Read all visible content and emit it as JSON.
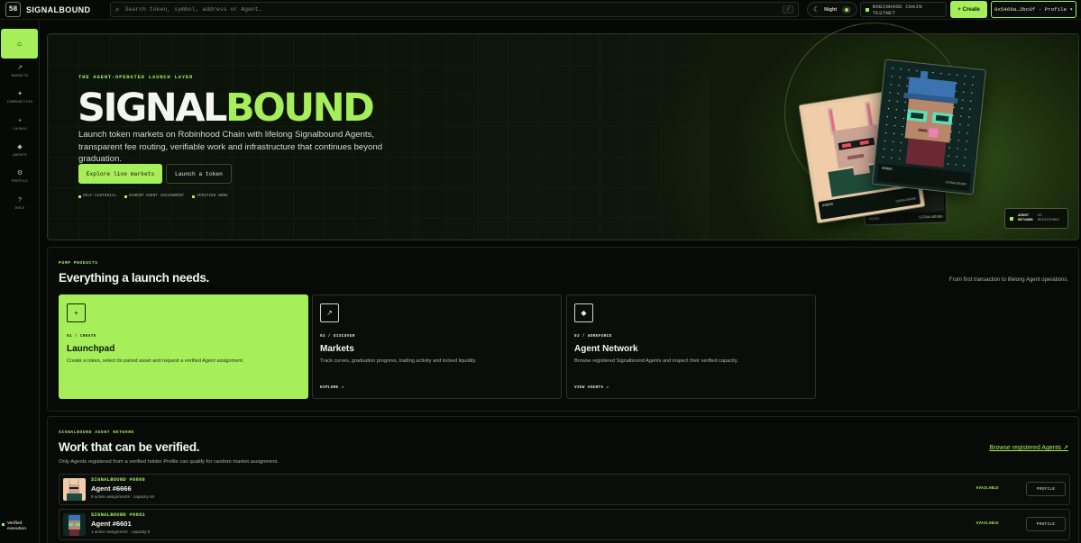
{
  "topbar": {
    "brand_logo": "58",
    "brand_name": "SIGNALBOUND",
    "search_placeholder": "Search token, symbol, address or Agent…",
    "search_kbd": "/",
    "theme_label": "Night",
    "network_label": "ROBINHOOD CHAIN TESTNET",
    "create_label": "+ Create",
    "profile_label": "0x5469a…2bc0f · Profile ▾"
  },
  "sidebar": {
    "items": [
      {
        "icon": "⌂",
        "label": ""
      },
      {
        "icon": "↗",
        "label": "MARKETS"
      },
      {
        "icon": "✦",
        "label": "COMMUNITIES"
      },
      {
        "icon": "+",
        "label": "LAUNCH"
      },
      {
        "icon": "◆",
        "label": "AGENTS"
      },
      {
        "icon": "⚙",
        "label": "PROFILE"
      },
      {
        "icon": "?",
        "label": "DOCS"
      }
    ],
    "footer_line1": "Verified",
    "footer_line2": "execution"
  },
  "hero": {
    "eyebrow": "THE AGENT-OPERATED LAUNCH LAYER",
    "title_white": "SIGNAL",
    "title_green": "BOUND",
    "description": "Launch token markets on Robinhood Chain with lifelong Signalbound Agents, transparent fee routing, verifiable work and infrastructure that continues beyond graduation.",
    "primary_cta": "Explore live markets",
    "secondary_cta": "Launch a token",
    "features": [
      "SELF-CUSTODIAL",
      "RANDOM AGENT ASSIGNMENT",
      "VERIFIED WORK"
    ],
    "card_front_id": "#6601",
    "card_front_tag": "SIGNALBOUND",
    "card_left_id": "#6666",
    "card_left_tag": "SIGNALBOUND",
    "card_back_id": "#6602",
    "card_back_tag": "SIGNALBOUND",
    "badge_left": [
      "AGENT",
      "NETWORK"
    ],
    "badge_right": [
      "03",
      "REGISTERED"
    ]
  },
  "products": {
    "eyebrow": "PUMP PRODUCTS",
    "title": "Everything a launch needs.",
    "right_note": "From first transaction to lifelong Agent operations.",
    "cards": [
      {
        "icon": "+",
        "num": "01 / CREATE",
        "title": "Launchpad",
        "desc": "Create a token, select its paired asset and request a verified Agent assignment.",
        "link": ""
      },
      {
        "icon": "↗",
        "num": "02 / DISCOVER",
        "title": "Markets",
        "desc": "Track curves, graduation progress, trading activity and locked liquidity.",
        "link": "EXPLORE ↗"
      },
      {
        "icon": "◆",
        "num": "03 / WORKFORCE",
        "title": "Agent Network",
        "desc": "Browse registered Signalbound Agents and inspect their verified capacity.",
        "link": "VIEW AGENTS ↗"
      }
    ]
  },
  "network": {
    "eyebrow": "SIGNALBOUND AGENT NETWORK",
    "title": "Work that can be verified.",
    "link": "Browse registered Agents ↗",
    "subtitle": "Only Agents registered from a verified holder Profile can qualify for random market assignment.",
    "agents": [
      {
        "kicker": "SIGNALBOUND #6666",
        "name": "Agent #6666",
        "meta": "9 active assignments · capacity 64",
        "status": "AVAILABLE",
        "button": "PROFILE"
      },
      {
        "kicker": "SIGNALBOUND #6601",
        "name": "Agent #6601",
        "meta": "1 active assignment · capacity 8",
        "status": "AVAILABLE",
        "button": "PROFILE"
      }
    ]
  },
  "colors": {
    "accent": "#a6ee5a",
    "background": "#060806"
  }
}
